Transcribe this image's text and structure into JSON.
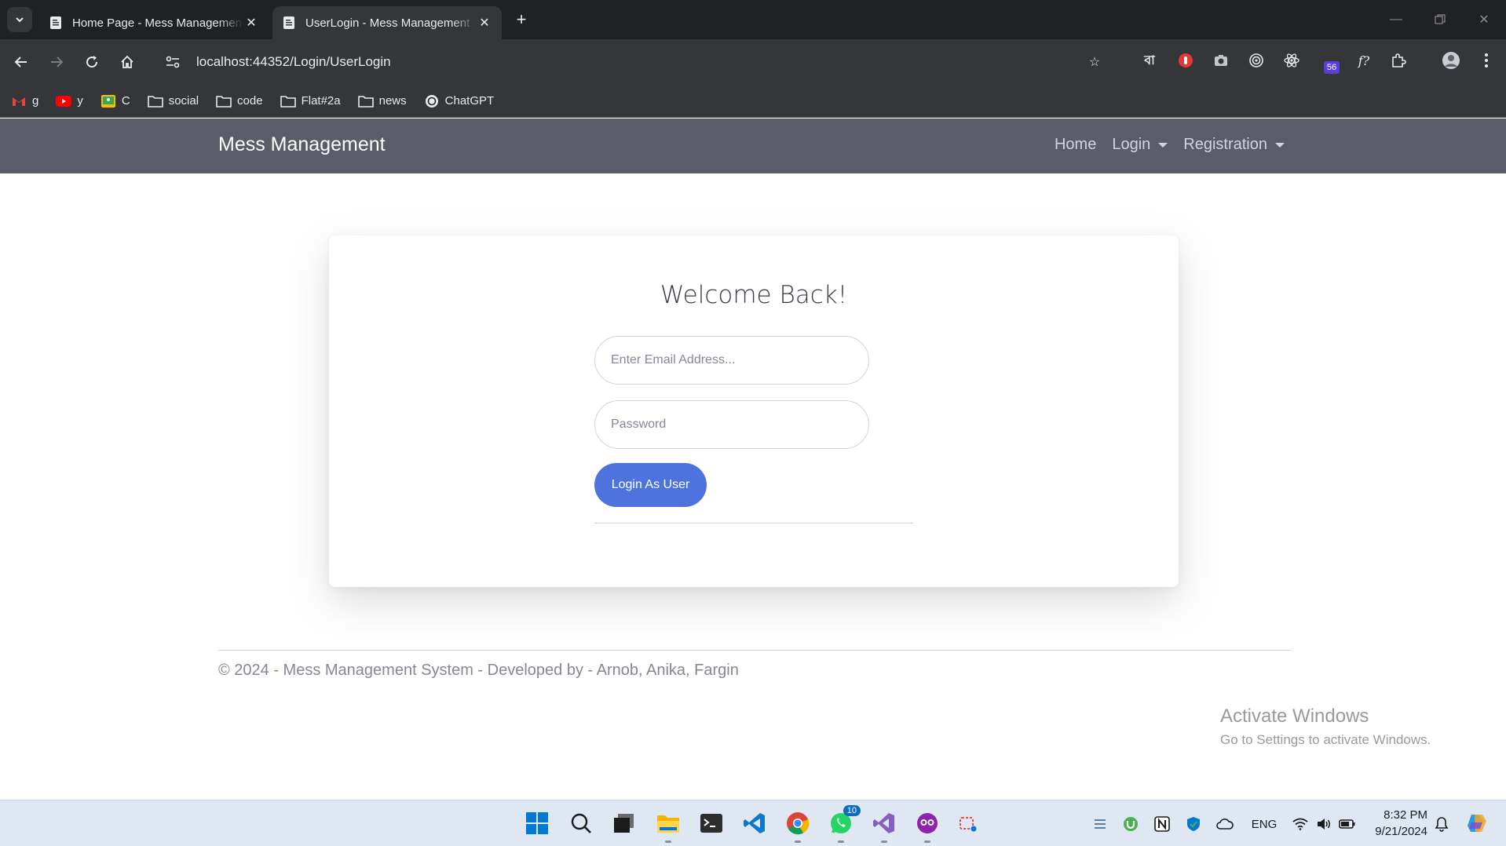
{
  "browser": {
    "tabs": [
      {
        "title": "Home Page - Mess Management",
        "active": false
      },
      {
        "title": "UserLogin - Mess Management",
        "active": true
      }
    ],
    "url": "localhost:44352/Login/UserLogin",
    "bookmarks": [
      {
        "label": "g",
        "icon": "gmail-icon"
      },
      {
        "label": "y",
        "icon": "youtube-icon"
      },
      {
        "label": "C",
        "icon": "classroom-icon"
      },
      {
        "label": "social",
        "icon": "folder-icon"
      },
      {
        "label": "code",
        "icon": "folder-icon"
      },
      {
        "label": "Flat#2a",
        "icon": "folder-icon"
      },
      {
        "label": "news",
        "icon": "folder-icon"
      },
      {
        "label": "ChatGPT",
        "icon": "chatgpt-icon"
      }
    ],
    "extensions": {
      "bangla_label": "বা",
      "badge_count": "56",
      "fx_label": "f?"
    }
  },
  "app": {
    "brand": "Mess Management",
    "nav": {
      "home": "Home",
      "login": "Login",
      "registration": "Registration"
    },
    "login_card": {
      "heading": "Welcome Back!",
      "email_placeholder": "Enter Email Address...",
      "password_placeholder": "Password",
      "submit_label": "Login As User"
    },
    "footer": "© 2024 - Mess Management System - Developed by - Arnob, Anika, Fargin"
  },
  "watermark": {
    "title": "Activate Windows",
    "subtitle": "Go to Settings to activate Windows."
  },
  "taskbar": {
    "whatsapp_badge": "10",
    "language": "ENG",
    "time": "8:32 PM",
    "date": "9/21/2024"
  }
}
